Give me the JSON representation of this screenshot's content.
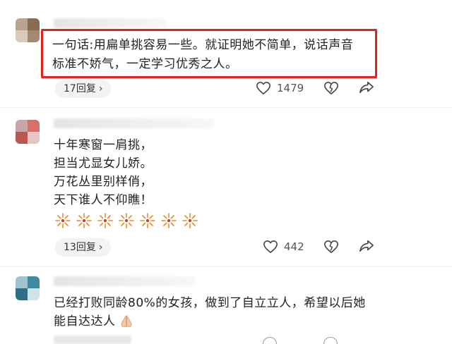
{
  "comments": [
    {
      "text_lines": [
        "一句话:用扁单挑容易一些。就证明她不简单，说话声音",
        "标准不娇气，一定学习优秀之人。"
      ],
      "reply_label": "17回复",
      "like_count": "1479",
      "highlight_color": "#e0231f"
    },
    {
      "text_lines": [
        "十年寒窗一肩挑，",
        "担当尤显女儿娇。",
        "万花丛里别样俏，",
        "天下谁人不仰瞧！"
      ],
      "emoji": [
        "fireworks-icon",
        "fireworks-icon",
        "fireworks-icon",
        "fireworks-icon",
        "fireworks-icon",
        "fireworks-icon",
        "fireworks-icon"
      ],
      "reply_label": "13回复",
      "like_count": "442"
    },
    {
      "text_lines": [
        "已经打败同龄80%的女孩，做到了自立立人，希望以后她",
        "能自达达人"
      ],
      "emoji_after": "folded-hands-icon"
    }
  ],
  "icons": [
    "chevron-right-icon",
    "heart-icon",
    "dislike-heart-icon",
    "share-icon"
  ]
}
